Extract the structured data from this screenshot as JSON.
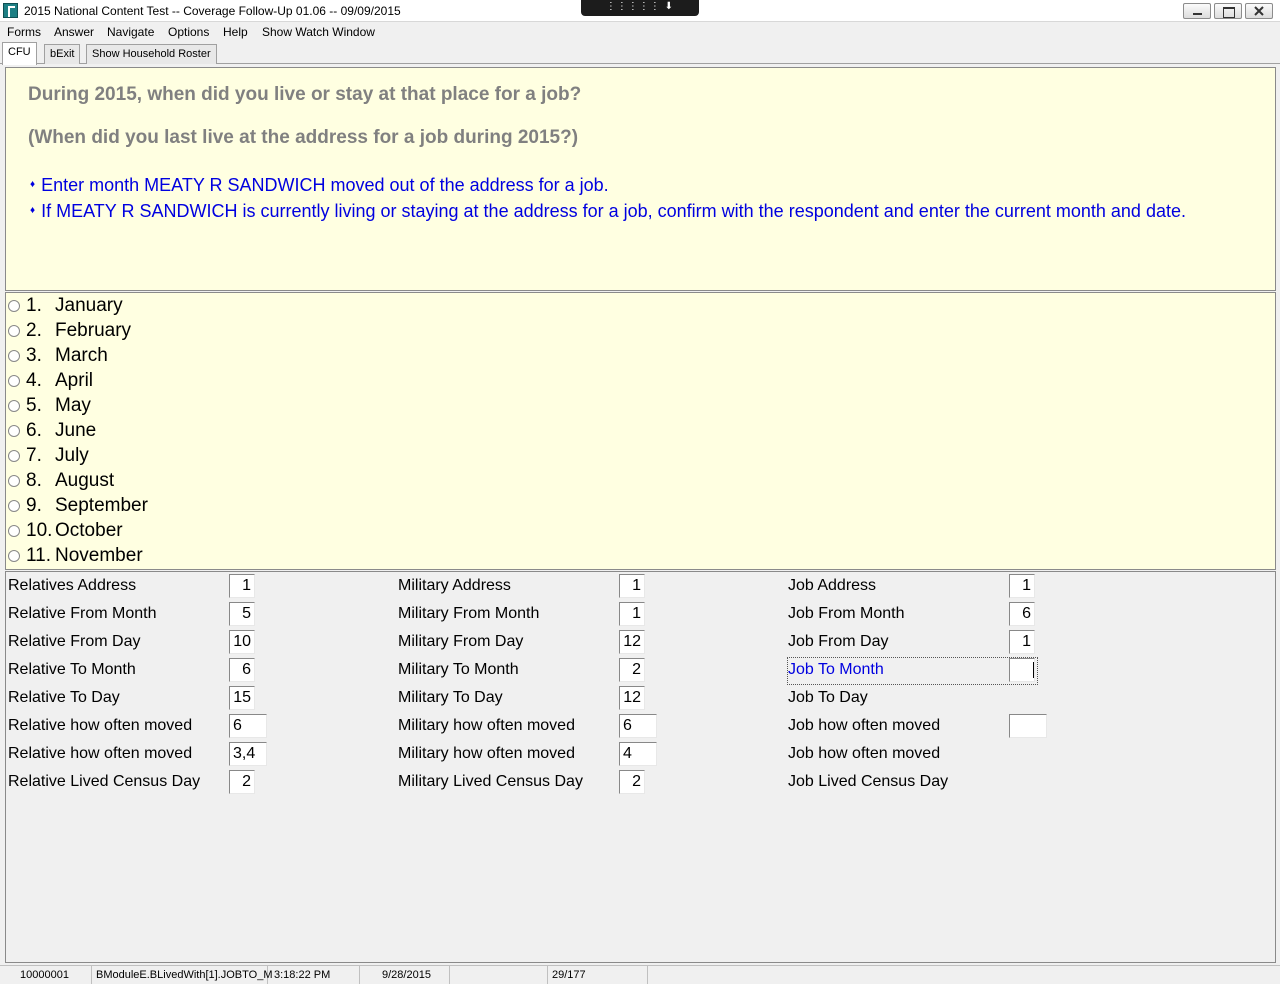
{
  "window": {
    "title": "2015 National Content Test -- Coverage Follow-Up 01.06 -- 09/09/2015",
    "remote_control_glyph": "⋮⋮⋮⋮⋮ ⬇ ⋮⋮⋮⋮⋮"
  },
  "menu": [
    "Forms",
    "Answer",
    "Navigate",
    "Options",
    "Help",
    "Show Watch Window"
  ],
  "tabs": [
    "CFU",
    "bExit",
    "Show Household Roster"
  ],
  "question": {
    "text": "During 2015, when did you live or stay at that place for a job?",
    "alt_text": "(When did you last live at the address for a job during 2015?)",
    "bullet": "♦",
    "instructions": [
      "Enter month MEATY R SANDWICH moved out of the address for a job.",
      "If MEATY R SANDWICH is currently living or staying at the address for a job, confirm with the respondent and enter the current month and date."
    ]
  },
  "options": [
    {
      "num": "1.",
      "label": "January"
    },
    {
      "num": "2.",
      "label": "February"
    },
    {
      "num": "3.",
      "label": "March"
    },
    {
      "num": "4.",
      "label": "April"
    },
    {
      "num": "5.",
      "label": "May"
    },
    {
      "num": "6.",
      "label": "June"
    },
    {
      "num": "7.",
      "label": "July"
    },
    {
      "num": "8.",
      "label": "August"
    },
    {
      "num": "9.",
      "label": "September"
    },
    {
      "num": "10.",
      "label": "October"
    },
    {
      "num": "11.",
      "label": "November"
    }
  ],
  "watch": {
    "relative": [
      {
        "label": "Relatives Address",
        "value": "1"
      },
      {
        "label": "Relative From Month",
        "value": "5"
      },
      {
        "label": "Relative From Day",
        "value": "10"
      },
      {
        "label": "Relative To Month",
        "value": "6"
      },
      {
        "label": "Relative To Day",
        "value": "15"
      },
      {
        "label": "Relative how often moved",
        "value": "6"
      },
      {
        "label": "Relative how often moved",
        "value": "3,4"
      },
      {
        "label": "Relative Lived Census Day",
        "value": "2"
      }
    ],
    "military": [
      {
        "label": "Military Address",
        "value": "1"
      },
      {
        "label": "Military From Month",
        "value": "1"
      },
      {
        "label": "Military From Day",
        "value": "12"
      },
      {
        "label": "Military To Month",
        "value": "2"
      },
      {
        "label": "Military To Day",
        "value": "12"
      },
      {
        "label": "Military how often moved",
        "value": "6"
      },
      {
        "label": "Military how often moved",
        "value": "4"
      },
      {
        "label": "Military Lived Census Day",
        "value": "2"
      }
    ],
    "job": [
      {
        "label": "Job Address",
        "value": "1"
      },
      {
        "label": "Job From Month",
        "value": "6"
      },
      {
        "label": "Job From Day",
        "value": "1"
      },
      {
        "label": "Job To Month",
        "value": ""
      },
      {
        "label": "Job To Day",
        "value": ""
      },
      {
        "label": "Job how often moved",
        "value": ""
      },
      {
        "label": "Job how often moved",
        "value": ""
      },
      {
        "label": "Job Lived Census Day",
        "value": ""
      }
    ]
  },
  "status": {
    "case_id": "10000001",
    "field": "BModuleE.BLivedWith[1].JOBTO_M",
    "time": "3:18:22 PM",
    "date": "9/28/2015",
    "blank": "",
    "page": "29/177"
  },
  "colors": {
    "panel_bg": "#ffffe1",
    "question_text": "#808080",
    "instruction_text": "#0000e0"
  }
}
